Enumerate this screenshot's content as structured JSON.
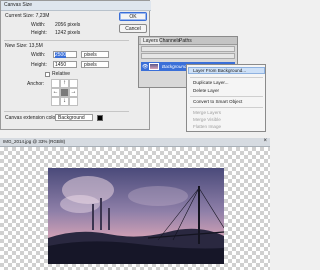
{
  "dialog": {
    "title": "Canvas Size",
    "current_size_label": "Current Size: 7,23M",
    "current_width_label": "Width:",
    "current_width_value": "2056 pixels",
    "current_height_label": "Height:",
    "current_height_value": "1242 pixels",
    "new_size_label": "New Size: 13,5M",
    "width_label": "Width:",
    "width_value": "2500",
    "height_label": "Height:",
    "height_value": "1450",
    "unit": "pixels",
    "relative_label": "Relative",
    "anchor_label": "Anchor:",
    "extension_color_label": "Canvas extension color:",
    "extension_color_value": "Background",
    "ok_label": "OK",
    "cancel_label": "Cancel"
  },
  "layers_panel": {
    "tabs": [
      "Layers",
      "Channels",
      "Paths"
    ],
    "layer_name": "Background"
  },
  "context_menu": {
    "items": [
      {
        "label": "Layer From Background...",
        "disabled": false,
        "highlight": true
      },
      {
        "label": "Duplicate Layer...",
        "disabled": false
      },
      {
        "label": "Delete Layer",
        "disabled": false
      },
      {
        "label": "Convert to Smart Object",
        "disabled": false
      },
      {
        "label": "Merge Layers",
        "disabled": true
      },
      {
        "label": "Merge Visible",
        "disabled": true
      },
      {
        "label": "Flatten Image",
        "disabled": true
      }
    ]
  },
  "document": {
    "tab_title": "IMG_2014.jpg @ 33% (RGB/8)"
  },
  "colors": {
    "accent": "#3a6fd8",
    "sky_top": "#5b5a8c",
    "sky_bottom": "#d6a3b6",
    "ground": "#1b1c2e"
  }
}
